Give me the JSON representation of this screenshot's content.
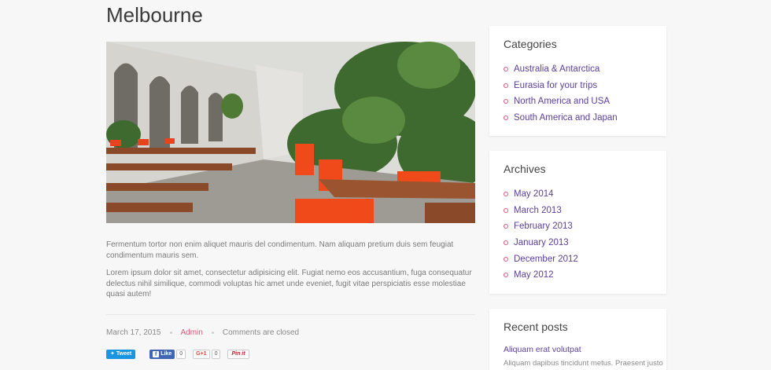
{
  "post": {
    "title": "Melbourne",
    "paragraphs": [
      "Fermentum tortor non enim aliquet mauris del condimentum. Nam aliquam pretium duis sem feugiat condimentum mauris sem.",
      "Lorem ipsum dolor sit amet, consectetur adipisicing elit. Fugiat nemo eos accusantium, fuga consequatur delectus nihil similique, commodi voluptas hic amet unde eveniet, fugit vitae perspiciatis esse molestiae quasi autem!"
    ],
    "date": "March 17, 2015",
    "author": "Admin",
    "comments": "Comments are closed"
  },
  "social": {
    "tweet_label": "Tweet",
    "like_label": "Like",
    "like_count": "0",
    "gplus_label": "G+1",
    "gplus_count": "0",
    "pin_label": "Pin it"
  },
  "sidebar": {
    "categories": {
      "title": "Categories",
      "items": [
        "Australia & Antarctica",
        "Eurasia for your trips",
        "North America and USA",
        "South America and Japan"
      ]
    },
    "archives": {
      "title": "Archives",
      "items": [
        "May 2014",
        "March 2013",
        "February 2013",
        "January 2013",
        "December 2012",
        "May 2012"
      ]
    },
    "recent": {
      "title": "Recent posts",
      "post_title": "Aliquam erat volutpat",
      "excerpt": "Aliquam dapibus tincidunt metus. Praesent justo"
    }
  },
  "colors": {
    "accent": "#e25478",
    "link": "#5b3f9a",
    "twitter": "#1b95e0",
    "facebook": "#4267b2"
  }
}
